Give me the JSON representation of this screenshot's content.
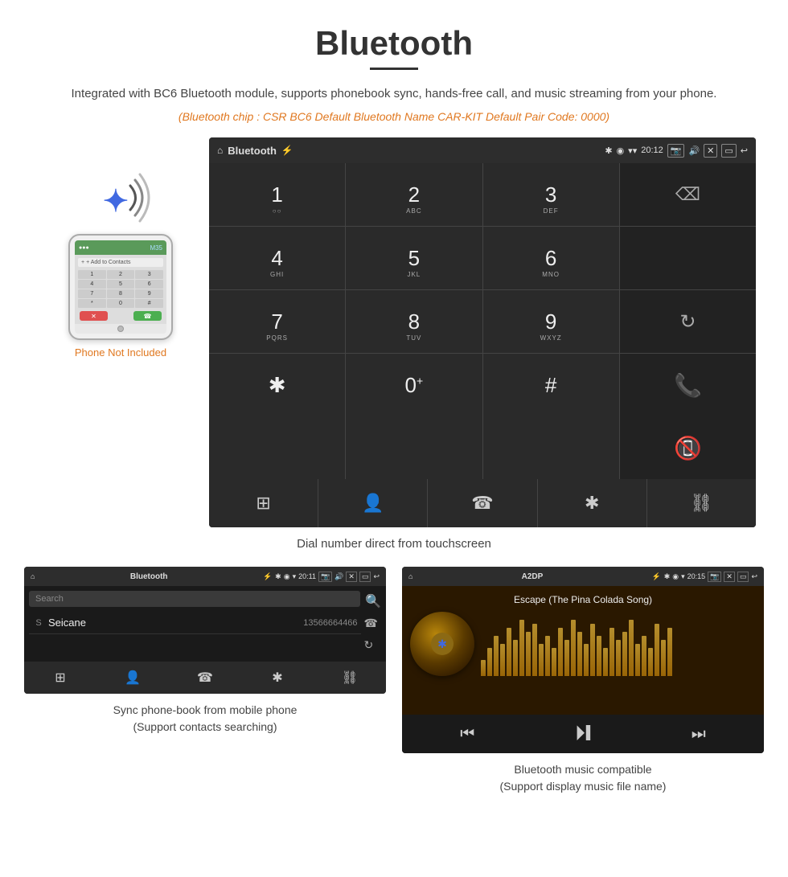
{
  "page": {
    "title": "Bluetooth",
    "subtitle": "Integrated with BC6 Bluetooth module, supports phonebook sync, hands-free call, and music streaming from your phone.",
    "specs": "(Bluetooth chip : CSR BC6    Default Bluetooth Name CAR-KIT    Default Pair Code: 0000)",
    "dial_caption": "Dial number direct from touchscreen",
    "phonebook_caption": "Sync phone-book from mobile phone\n(Support contacts searching)",
    "music_caption": "Bluetooth music compatible\n(Support display music file name)"
  },
  "status_bar": {
    "home_icon": "⌂",
    "screen_name": "Bluetooth",
    "usb_icon": "⚡",
    "bt_icon": "✱",
    "location_icon": "◉",
    "signal_icon": "▾",
    "time": "20:12",
    "camera_icon": "⬜",
    "volume_icon": "🔊",
    "close_icon": "✕",
    "window_icon": "⬜",
    "back_icon": "↩"
  },
  "dialpad": {
    "keys": [
      {
        "num": "1",
        "sub": ""
      },
      {
        "num": "2",
        "sub": "ABC"
      },
      {
        "num": "3",
        "sub": "DEF"
      },
      {
        "num": "4",
        "sub": "GHI"
      },
      {
        "num": "5",
        "sub": "JKL"
      },
      {
        "num": "6",
        "sub": "MNO"
      },
      {
        "num": "7",
        "sub": "PQRS"
      },
      {
        "num": "8",
        "sub": "TUV"
      },
      {
        "num": "9",
        "sub": "WXYZ"
      },
      {
        "num": "*",
        "sub": ""
      },
      {
        "num": "0",
        "sub": "+"
      },
      {
        "num": "#",
        "sub": ""
      }
    ]
  },
  "phone_mockup": {
    "add_contacts": "+ Add to Contacts",
    "keypad_keys": [
      "1",
      "2",
      "3",
      "4",
      "5",
      "6",
      "7",
      "8",
      "9",
      "*",
      "0",
      "#"
    ],
    "not_included": "Phone Not Included"
  },
  "phonebook": {
    "screen_name": "Bluetooth",
    "time": "20:11",
    "search_placeholder": "Search",
    "contact_letter": "S",
    "contact_name": "Seicane",
    "contact_number": "13566664466"
  },
  "music": {
    "screen_name": "A2DP",
    "time": "20:15",
    "song_title": "Escape (The Pina Colada Song)",
    "eq_bars": [
      20,
      35,
      50,
      40,
      60,
      45,
      70,
      55,
      65,
      40,
      50,
      35,
      60,
      45,
      70,
      55,
      40,
      65,
      50,
      35,
      60,
      45,
      55,
      70,
      40,
      50,
      35,
      65,
      45,
      60
    ]
  },
  "bottom_icons": {
    "grid": "⊞",
    "person": "👤",
    "phone": "☎",
    "bluetooth": "✱",
    "link": "🔗"
  }
}
